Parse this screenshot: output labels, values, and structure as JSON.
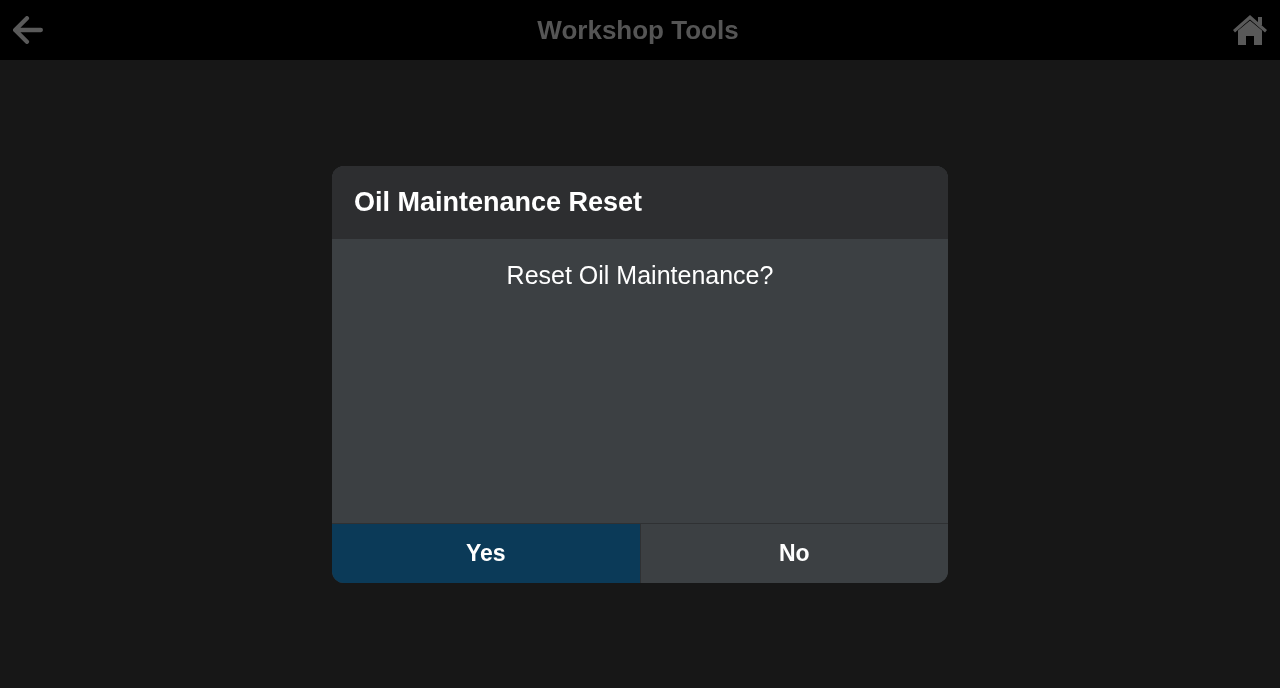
{
  "top_bar": {
    "title": "Workshop Tools"
  },
  "dialog": {
    "title": "Oil Maintenance Reset",
    "message": "Reset Oil Maintenance?",
    "buttons": [
      {
        "label": "Yes",
        "selected": true
      },
      {
        "label": "No",
        "selected": false
      }
    ]
  }
}
